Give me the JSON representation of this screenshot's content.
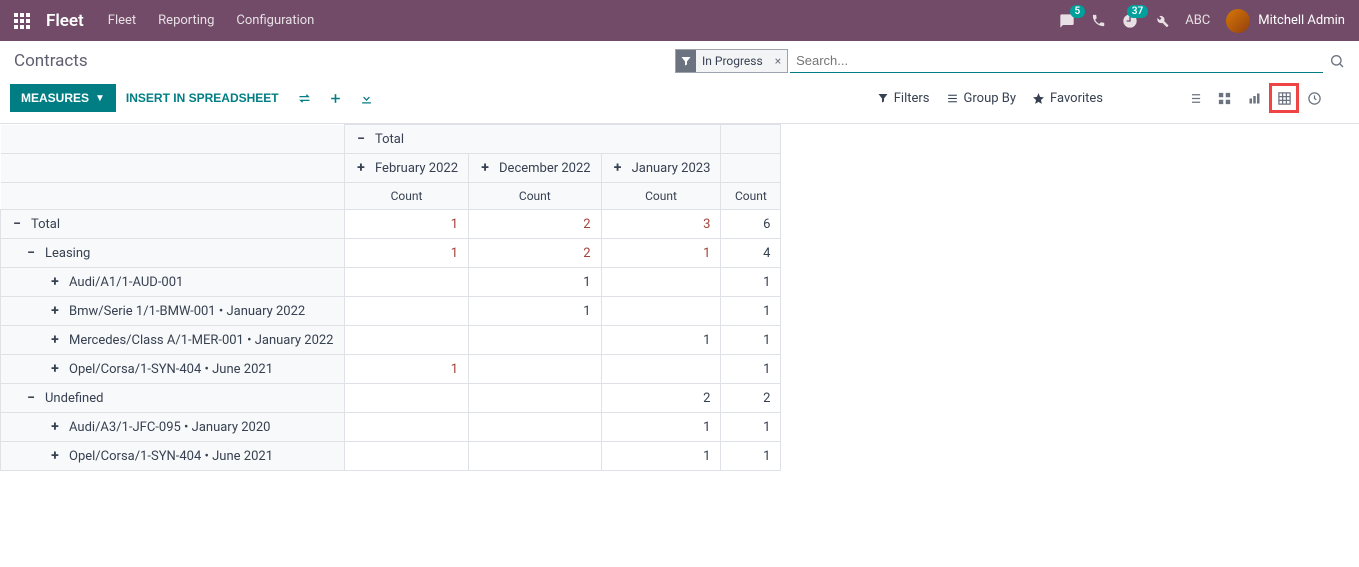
{
  "navbar": {
    "brand": "Fleet",
    "menu": [
      "Fleet",
      "Reporting",
      "Configuration"
    ],
    "msg_count": "5",
    "activity_count": "37",
    "debug_label": "ABC",
    "user_name": "Mitchell Admin"
  },
  "header": {
    "title": "Contracts",
    "filter_chip": "In Progress",
    "search_placeholder": "Search..."
  },
  "toolbar": {
    "measures": "MEASURES",
    "insert": "INSERT IN SPREADSHEET",
    "filters": "Filters",
    "groupby": "Group By",
    "favorites": "Favorites"
  },
  "pivot": {
    "top_total": "Total",
    "col_headers": [
      "February 2022",
      "December 2022",
      "January 2023"
    ],
    "measure": "Count",
    "rows": [
      {
        "level": 0,
        "icon": "minus",
        "label": "Total",
        "vals": [
          "1",
          "2",
          "3",
          "6"
        ]
      },
      {
        "level": 1,
        "icon": "minus",
        "label": "Leasing",
        "vals": [
          "1",
          "2",
          "1",
          "4"
        ]
      },
      {
        "level": 2,
        "icon": "plus",
        "label": "Audi/A1/1-AUD-001",
        "vals": [
          "",
          "1",
          "",
          "1"
        ]
      },
      {
        "level": 2,
        "icon": "plus",
        "label": "Bmw/Serie 1/1-BMW-001 • January 2022",
        "vals": [
          "",
          "1",
          "",
          "1"
        ]
      },
      {
        "level": 2,
        "icon": "plus",
        "label": "Mercedes/Class A/1-MER-001 • January 2022",
        "vals": [
          "",
          "",
          "1",
          "1"
        ]
      },
      {
        "level": 2,
        "icon": "plus",
        "label": "Opel/Corsa/1-SYN-404 • June 2021",
        "vals": [
          "1",
          "",
          "",
          "1"
        ]
      },
      {
        "level": 1,
        "icon": "minus",
        "label": "Undefined",
        "vals": [
          "",
          "",
          "2",
          "2"
        ]
      },
      {
        "level": 2,
        "icon": "plus",
        "label": "Audi/A3/1-JFC-095 • January 2020",
        "vals": [
          "",
          "",
          "1",
          "1"
        ]
      },
      {
        "level": 2,
        "icon": "plus",
        "label": "Opel/Corsa/1-SYN-404 • June 2021",
        "vals": [
          "",
          "",
          "1",
          "1"
        ]
      }
    ]
  }
}
